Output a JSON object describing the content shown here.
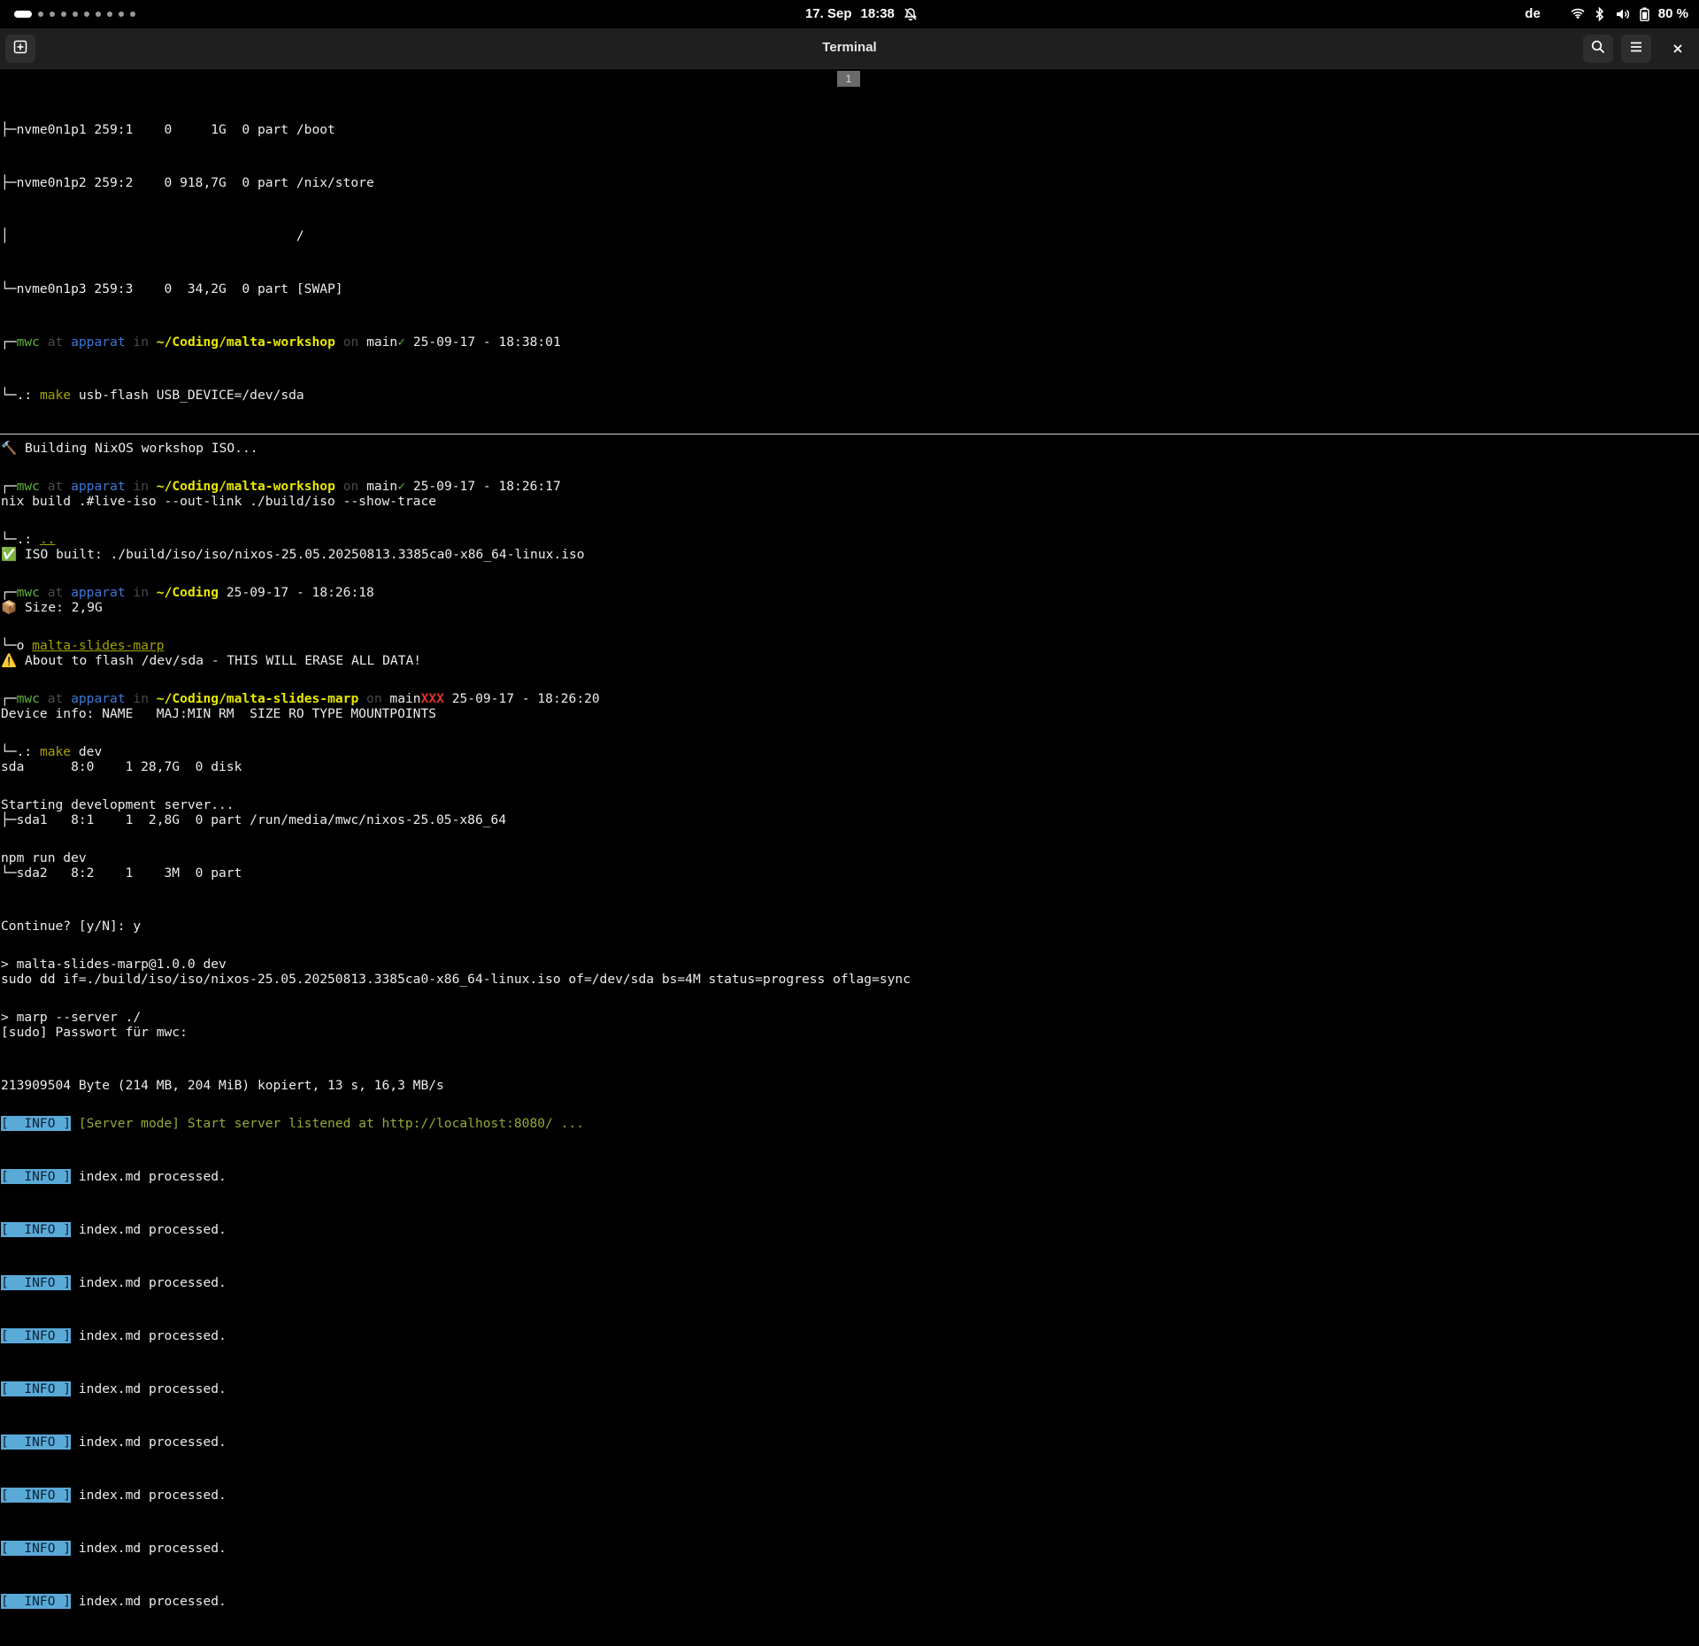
{
  "topbar": {
    "date": "17. Sep",
    "time": "18:38",
    "keyboard_layout": "de",
    "battery_percent": "80 %",
    "icons": [
      "notifications-muted-icon",
      "wifi-icon",
      "bluetooth-icon",
      "volume-icon",
      "battery-icon"
    ]
  },
  "window": {
    "title": "Terminal",
    "tab_number": "1"
  },
  "top_pane": {
    "lsblk_tail": [
      "├─nvme0n1p1 259:1    0     1G  0 part /boot",
      "├─nvme0n1p2 259:2    0 918,7G  0 part /nix/store",
      "│                                     /",
      "└─nvme0n1p3 259:3    0  34,2G  0 part [SWAP]"
    ],
    "prompt": {
      "user": "mwc",
      "at": "at",
      "host": "apparat",
      "in": "in",
      "path": "~/Coding/malta-workshop",
      "on": "on",
      "branch": "main",
      "branch_mark": "✓",
      "timestamp": "25-09-17 - 18:38:01",
      "cmd_name": "make",
      "cmd_args": "usb-flash USB_DEVICE=/dev/sda"
    },
    "output": [
      "🔨 Building NixOS workshop ISO...",
      "nix build .#live-iso --out-link ./build/iso --show-trace",
      "✅ ISO built: ./build/iso/iso/nixos-25.05.20250813.3385ca0-x86_64-linux.iso",
      "📦 Size: 2,9G",
      "⚠️ About to flash /dev/sda - THIS WILL ERASE ALL DATA!",
      "Device info: NAME   MAJ:MIN RM  SIZE RO TYPE MOUNTPOINTS",
      "sda      8:0    1 28,7G  0 disk",
      "├─sda1   8:1    1  2,8G  0 part /run/media/mwc/nixos-25.05-x86_64",
      "└─sda2   8:2    1    3M  0 part",
      "Continue? [y/N]: y",
      "sudo dd if=./build/iso/iso/nixos-25.05.20250813.3385ca0-x86_64-linux.iso of=/dev/sda bs=4M status=progress oflag=sync",
      "[sudo] Passwort für mwc:",
      "213909504 Byte (214 MB, 204 MiB) kopiert, 13 s, 16,3 MB/s"
    ]
  },
  "bottom_pane": {
    "prompt1": {
      "user": "mwc",
      "at": "at",
      "host": "apparat",
      "in": "in",
      "path": "~/Coding/malta-workshop",
      "on": "on",
      "branch": "main",
      "branch_mark": "✓",
      "timestamp": "25-09-17 - 18:26:17",
      "cmd": ".."
    },
    "prompt2": {
      "user": "mwc",
      "at": "at",
      "host": "apparat",
      "in": "in",
      "path": "~/Coding",
      "timestamp": "25-09-17 - 18:26:18",
      "cmd": "malta-slides-marp"
    },
    "prompt3": {
      "user": "mwc",
      "at": "at",
      "host": "apparat",
      "in": "in",
      "path": "~/Coding/malta-slides-marp",
      "on": "on",
      "branch": "main",
      "branch_mark": "XXX",
      "timestamp": "25-09-17 - 18:26:20",
      "cmd_name": "make",
      "cmd_args": "dev"
    },
    "output": [
      "Starting development server...",
      "npm run dev",
      "",
      "> malta-slides-marp@1.0.0 dev",
      "> marp --server ./",
      ""
    ],
    "info_label": "[  INFO ]",
    "server_message": "[Server mode] Start server listened at http://localhost:8080/ ...",
    "processed_lines": [
      "index.md processed.",
      "index.md processed.",
      "index.md processed.",
      "index.md processed.",
      "index.md processed.",
      "index.md processed.",
      "index.md processed.",
      "index.md processed.",
      "index.md processed."
    ]
  }
}
